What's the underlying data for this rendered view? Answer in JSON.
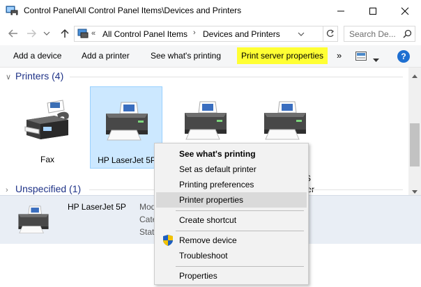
{
  "window": {
    "title": "Control Panel\\All Control Panel Items\\Devices and Printers",
    "minimize_glyph": "—",
    "maximize_glyph": "☐",
    "close_glyph": "✕"
  },
  "address": {
    "chevrons": "«",
    "crumb1": "All Control Panel Items",
    "sep": "›",
    "crumb2": "Devices and Printers",
    "search_placeholder": "Search De..."
  },
  "toolbar": {
    "add_device": "Add a device",
    "add_printer": "Add a printer",
    "see_printing": "See what's printing",
    "print_server": "Print server properties",
    "more": "»",
    "help": "?",
    "highlight_color": "#ffff33"
  },
  "groups": {
    "printers": {
      "chev": "∨",
      "label": "Printers (4)"
    },
    "unspecified": {
      "chev": "›",
      "label": "Unspecified (1)"
    }
  },
  "devices": [
    {
      "label": "Fax"
    },
    {
      "label": "HP LaserJet 5P"
    },
    {
      "label": ""
    },
    {
      "label": "S",
      "label2": "ter"
    }
  ],
  "details": {
    "name": "HP LaserJet 5P",
    "field1": "Mod",
    "field2": "Categ",
    "field3": "Stat"
  },
  "context_menu": {
    "items": [
      {
        "label": "See what's printing"
      },
      {
        "label": "Set as default printer"
      },
      {
        "label": "Printing preferences"
      },
      {
        "label": "Printer properties"
      },
      {
        "label": "Create shortcut"
      },
      {
        "label": "Remove device"
      },
      {
        "label": "Troubleshoot"
      },
      {
        "label": "Properties"
      }
    ]
  }
}
